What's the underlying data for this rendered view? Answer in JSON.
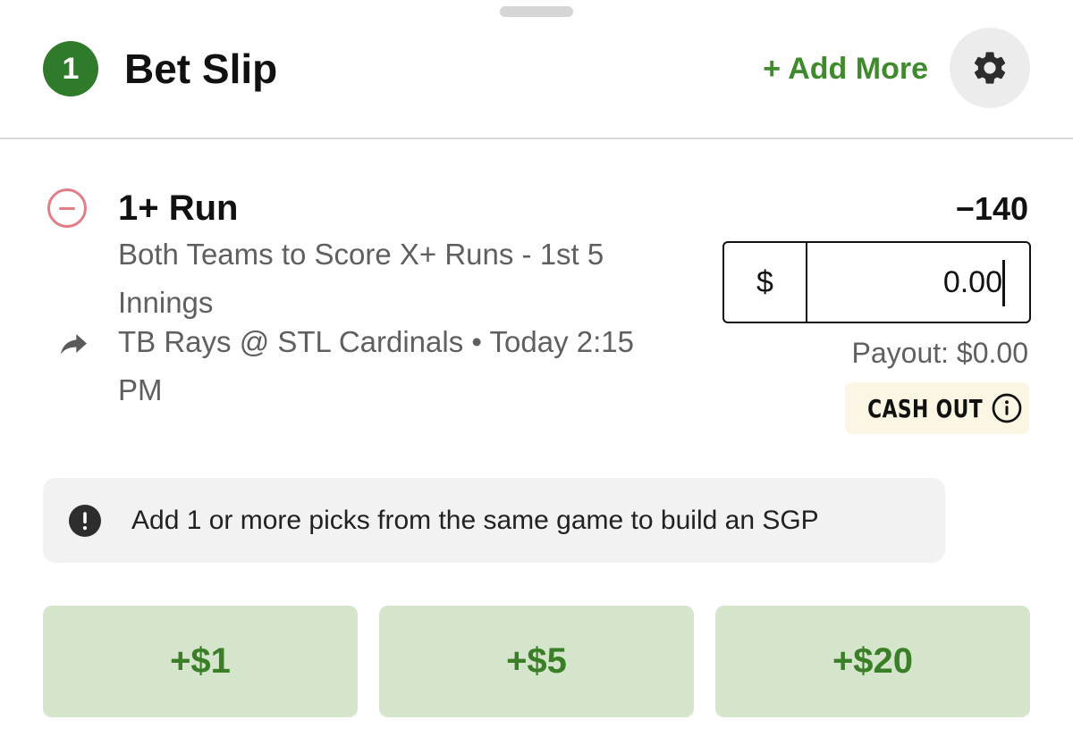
{
  "header": {
    "count": "1",
    "title": "Bet Slip",
    "add_more_label": "+ Add More",
    "settings_icon": "gear-icon"
  },
  "bet": {
    "selection": "1+ Run",
    "market": "Both Teams to Score X+ Runs - 1st 5 Innings",
    "game": "TB Rays @ STL Cardinals • Today 2:15 PM",
    "odds": "−140",
    "stake_currency": "$",
    "stake_value": "0.00",
    "payout": "Payout: $0.00",
    "cash_out_label": "CASH OUT"
  },
  "notice": {
    "text": "Add 1 or more picks from the same game to build an SGP"
  },
  "quick_amounts": [
    "+$1",
    "+$5",
    "+$20"
  ],
  "colors": {
    "accent_green": "#3f8a2c",
    "badge_green": "#2f7a2b",
    "quick_button_bg": "#d4e5cc",
    "remove_red": "#e07d86",
    "cashout_bg": "#fbf6e3"
  }
}
